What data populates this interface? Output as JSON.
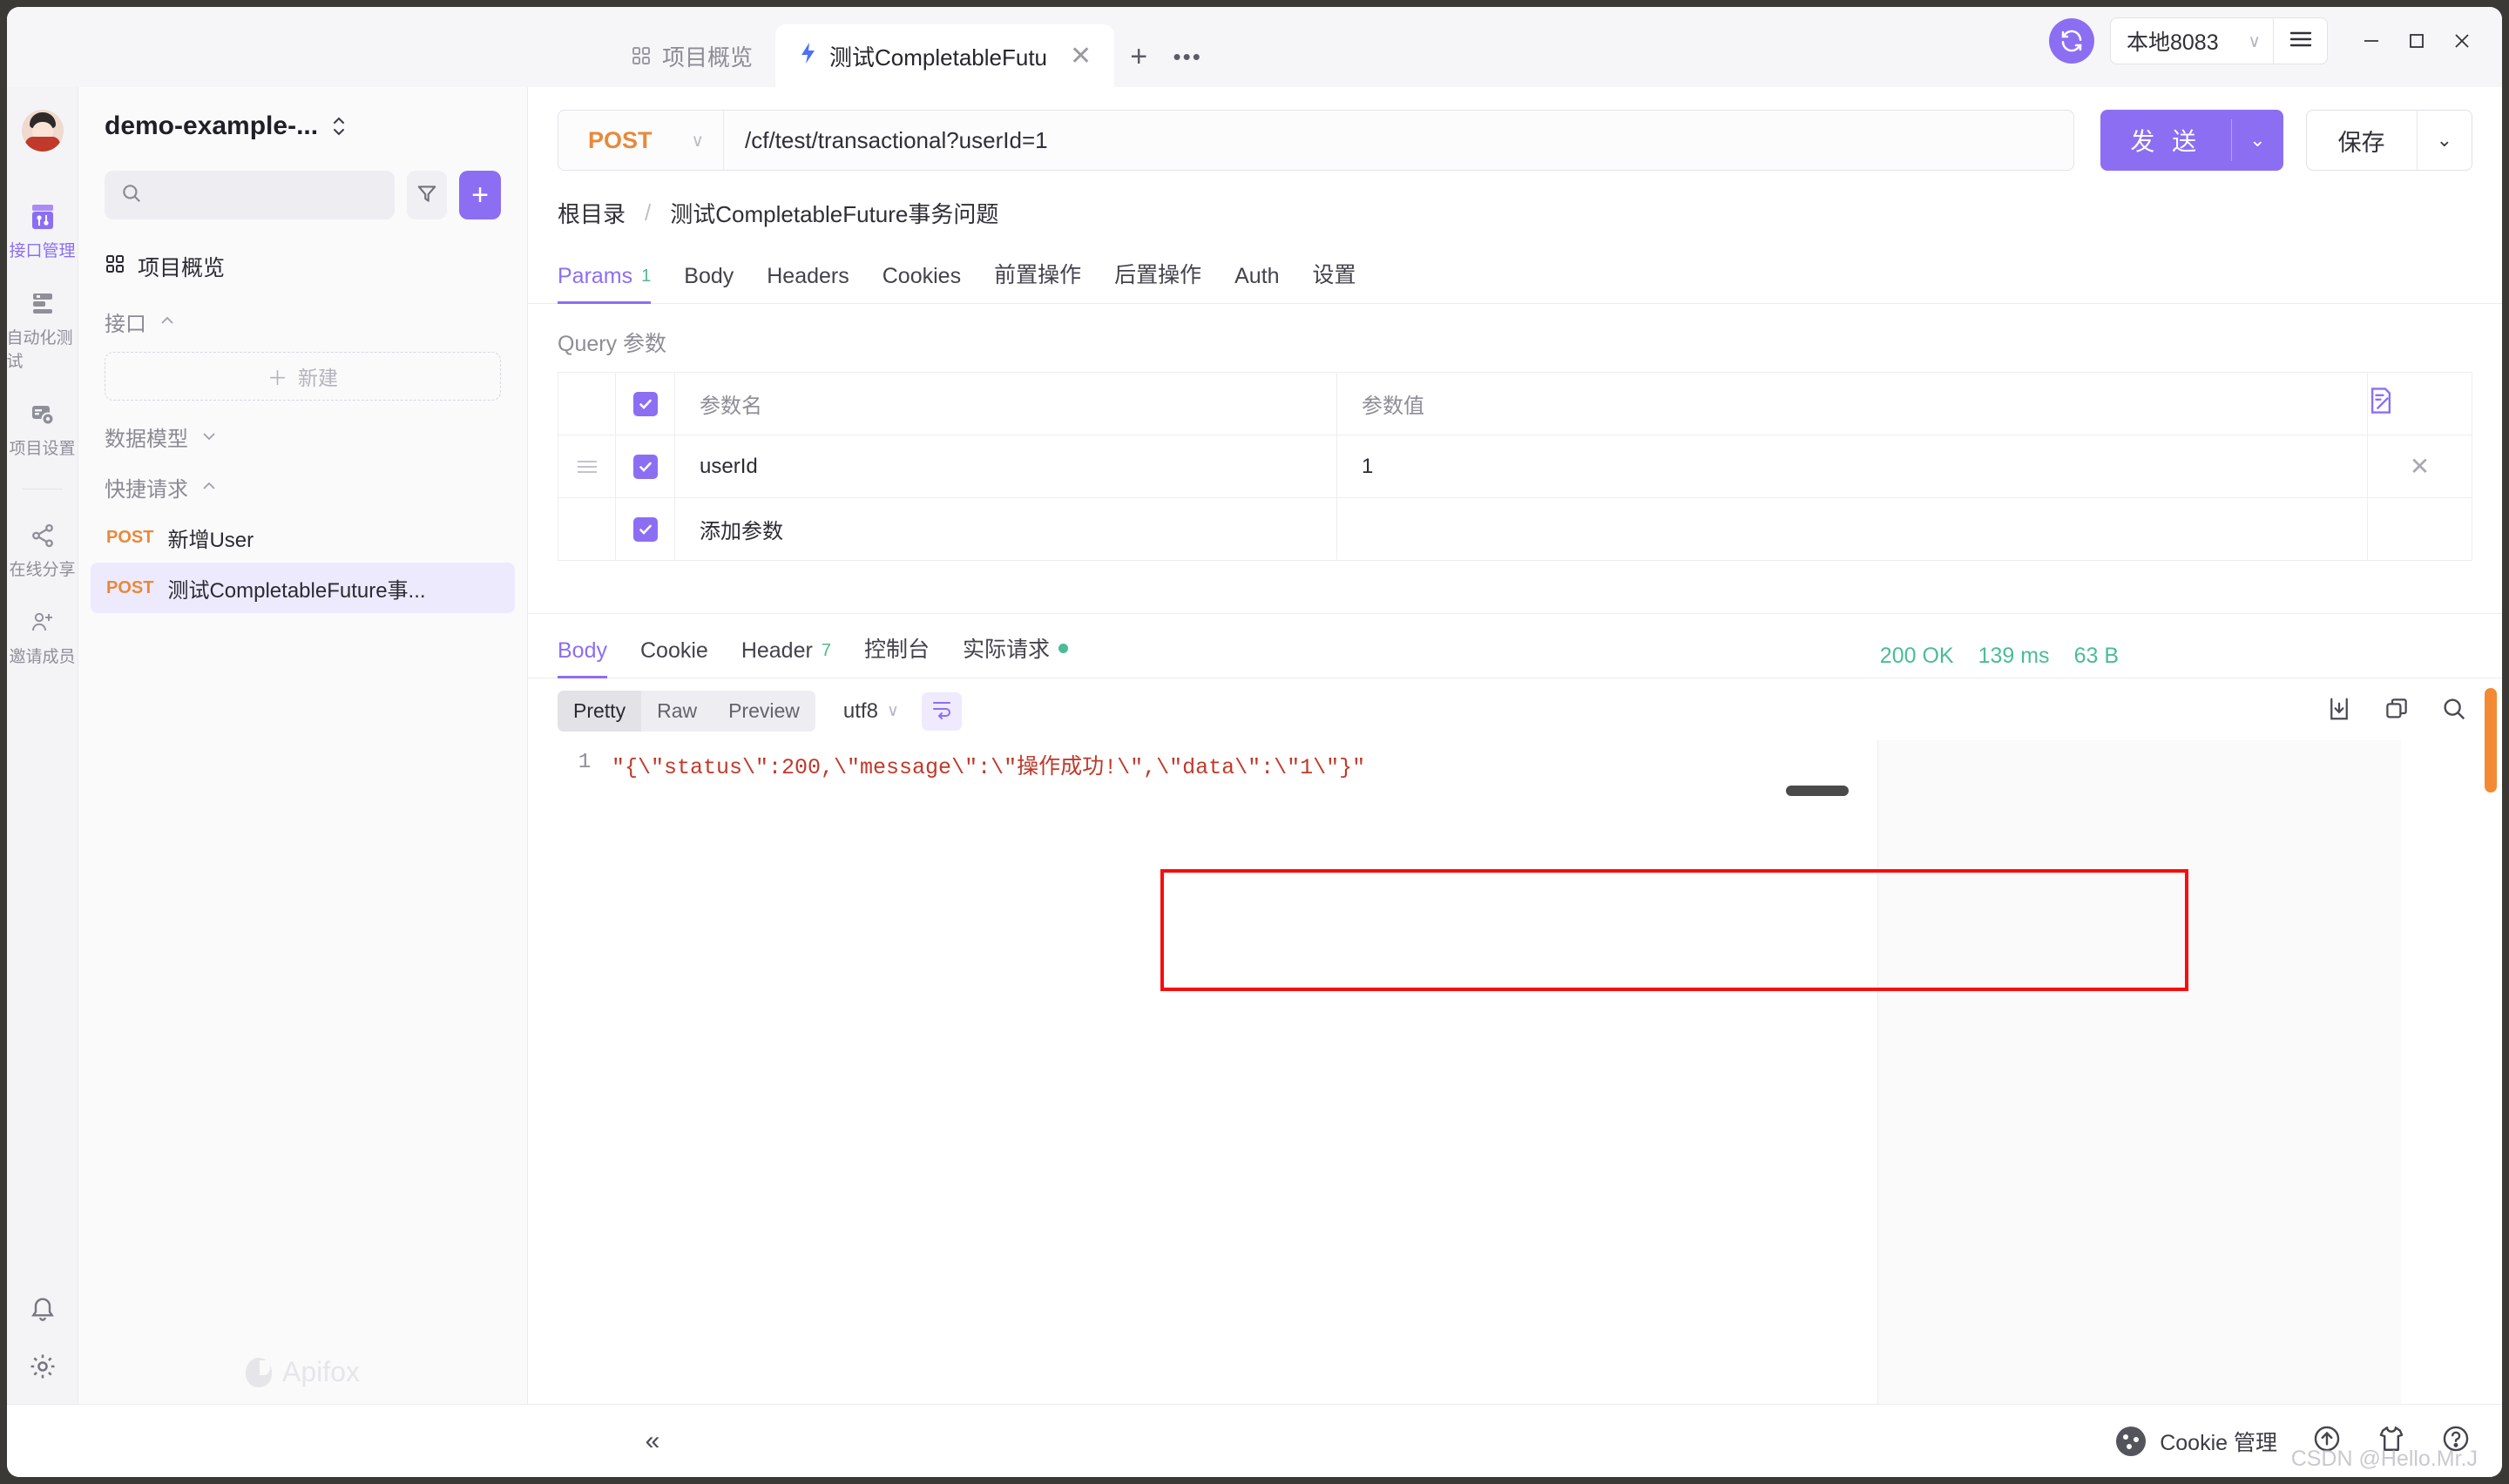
{
  "window": {
    "minimize": "—",
    "maximize": "□",
    "close": "✕"
  },
  "topbar": {
    "tabs": [
      {
        "label": "项目概览",
        "icon": "grid-icon",
        "active": false
      },
      {
        "label": "测试CompletableFutu",
        "icon": "lightning-icon",
        "active": true
      }
    ],
    "new_tab": "+",
    "more_tabs": "•••",
    "environment": "本地8083",
    "env_caret": "∨"
  },
  "rail": {
    "items": [
      {
        "label": "接口管理",
        "icon": "api-icon",
        "active": true
      },
      {
        "label": "自动化测试",
        "icon": "automation-icon",
        "active": false
      },
      {
        "label": "项目设置",
        "icon": "settings-project-icon",
        "active": false
      },
      {
        "label": "在线分享",
        "icon": "share-icon",
        "active": false
      },
      {
        "label": "邀请成员",
        "icon": "invite-member-icon",
        "active": false
      }
    ]
  },
  "tree": {
    "project_name": "demo-example-...",
    "search_placeholder": "",
    "filter_icon": "filter-icon",
    "add_label": "+",
    "overview_label": "项目概览",
    "groups": [
      {
        "label": "接口",
        "caret": "︿"
      },
      {
        "label": "数据模型",
        "caret": "﹀"
      },
      {
        "label": "快捷请求",
        "caret": "︿"
      }
    ],
    "new_button": "新建",
    "new_button_plus": "＋",
    "api_items": [
      {
        "method": "POST",
        "name": "新增User",
        "selected": false
      },
      {
        "method": "POST",
        "name": "测试CompletableFuture事...",
        "selected": true
      }
    ],
    "brand": "Apifox"
  },
  "request": {
    "method": "POST",
    "method_caret": "∨",
    "url": "/cf/test/transactional?userId=1",
    "send_label": "发 送",
    "send_caret": "⌄",
    "save_label": "保存",
    "save_caret": "⌄",
    "breadcrumb": {
      "root": "根目录",
      "separator": "/",
      "current": "测试CompletableFuture事务问题"
    },
    "tabs": [
      {
        "label": "Params",
        "count": "1",
        "active": true
      },
      {
        "label": "Body",
        "count": "",
        "active": false
      },
      {
        "label": "Headers",
        "count": "",
        "active": false
      },
      {
        "label": "Cookies",
        "count": "",
        "active": false
      },
      {
        "label": "前置操作",
        "count": "",
        "active": false
      },
      {
        "label": "后置操作",
        "count": "",
        "active": false
      },
      {
        "label": "Auth",
        "count": "",
        "active": false
      },
      {
        "label": "设置",
        "count": "",
        "active": false
      }
    ],
    "params_title": "Query 参数",
    "params_headers": {
      "name": "参数名",
      "value": "参数值"
    },
    "params_rows": [
      {
        "checked": true,
        "name": "userId",
        "value": "1",
        "placeholder": false
      },
      {
        "checked": true,
        "name": "添加参数",
        "value": "",
        "placeholder": true
      }
    ],
    "bulk_edit_icon": "bulk-edit-icon",
    "row_remove": "✕"
  },
  "response": {
    "tabs": [
      {
        "label": "Body",
        "count": "",
        "dot": false,
        "active": true
      },
      {
        "label": "Cookie",
        "count": "",
        "dot": false,
        "active": false
      },
      {
        "label": "Header",
        "count": "7",
        "dot": false,
        "active": false
      },
      {
        "label": "控制台",
        "count": "",
        "dot": false,
        "active": false
      },
      {
        "label": "实际请求",
        "count": "",
        "dot": true,
        "active": false
      }
    ],
    "status": {
      "code": "200 OK",
      "time": "139 ms",
      "size": "63 B"
    },
    "view_modes": [
      {
        "label": "Pretty",
        "active": true
      },
      {
        "label": "Raw",
        "active": false
      },
      {
        "label": "Preview",
        "active": false
      }
    ],
    "encoding": "utf8",
    "encoding_caret": "∨",
    "wrap_icon": "word-wrap-icon",
    "tools": [
      {
        "icon": "download-icon"
      },
      {
        "icon": "copy-icon"
      },
      {
        "icon": "search-icon"
      }
    ],
    "body_line_number": "1",
    "body_text": "\"{\\\"status\\\":200,\\\"message\\\":\\\"操作成功!\\\",\\\"data\\\":\\\"1\\\"}\""
  },
  "bottombar": {
    "collapse": "«",
    "cookie_label": "Cookie 管理",
    "upgrade_icon": "upload-arrow-icon",
    "theme_icon": "shirt-icon",
    "help_icon": "help-icon",
    "watermark": "CSDN @Hello.Mr.J"
  },
  "colors": {
    "accent": "#8c6ef3",
    "method_post": "#e8893b",
    "success": "#49bd94",
    "code_string": "#c0392b",
    "highlight_border": "#fa0c0c"
  }
}
